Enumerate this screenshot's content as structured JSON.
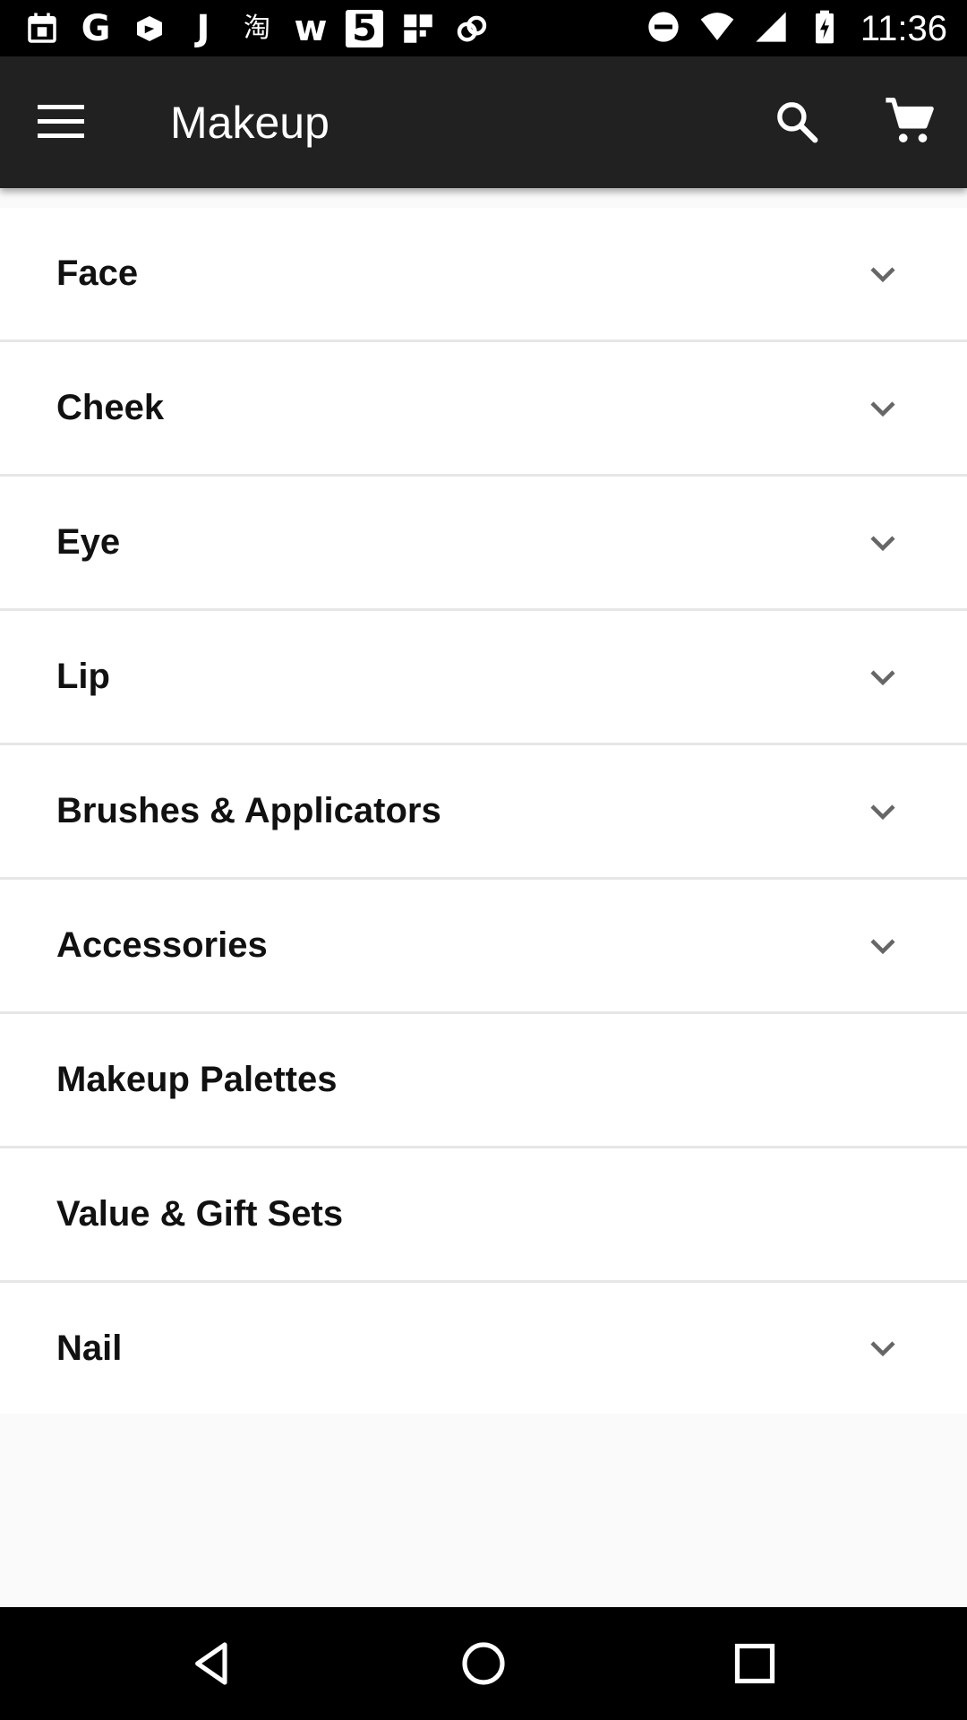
{
  "status_bar": {
    "time": "11:36",
    "notification_icons": [
      "calendar-icon",
      "g-icon",
      "drive-icon",
      "j-icon",
      "taobao-icon",
      "wish-icon",
      "five-icon",
      "grid-icon",
      "link-icon"
    ],
    "status_icons": [
      "dnd-icon",
      "wifi-icon",
      "cell-signal-icon",
      "battery-charging-icon"
    ],
    "glyphs": {
      "g": "G",
      "j": "J",
      "taobao": "淘",
      "w": "w",
      "five": "5"
    }
  },
  "app_bar": {
    "title": "Makeup",
    "background": "#212121"
  },
  "categories": [
    {
      "label": "Face",
      "expandable": true
    },
    {
      "label": "Cheek",
      "expandable": true
    },
    {
      "label": "Eye",
      "expandable": true
    },
    {
      "label": "Lip",
      "expandable": true
    },
    {
      "label": "Brushes & Applicators",
      "expandable": true
    },
    {
      "label": "Accessories",
      "expandable": true
    },
    {
      "label": "Makeup Palettes",
      "expandable": false
    },
    {
      "label": "Value & Gift Sets",
      "expandable": false
    },
    {
      "label": "Nail",
      "expandable": true
    }
  ],
  "nav_bar": {
    "buttons": [
      "back-icon",
      "home-icon",
      "recents-icon"
    ]
  }
}
